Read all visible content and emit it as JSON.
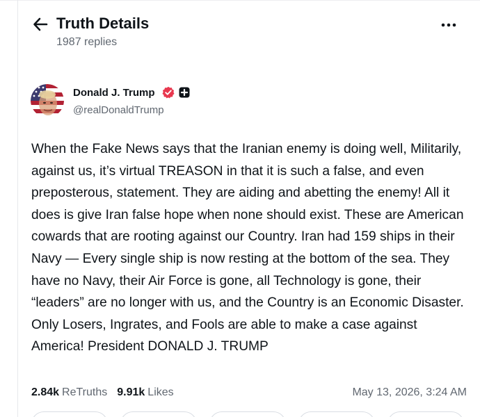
{
  "header": {
    "title": "Truth Details",
    "replies": "1987 replies",
    "back_icon": "arrow-left-icon",
    "more_icon": "more-horizontal-icon"
  },
  "author": {
    "name": "Donald J. Trump",
    "handle": "@realDonaldTrump",
    "verified_icon": "verified-badge-icon",
    "verified_color": "#e8384f",
    "plus_icon": "plus-badge-icon"
  },
  "post": {
    "text": "When the Fake News says that the Iranian enemy is doing well, Militarily, against us, it’s virtual TREASON in that it is such a false, and even preposterous, statement. They are aiding and abetting the enemy! All it does is give Iran false hope when none should exist. These are American cowards that are rooting against our Country. Iran had 159 ships in their Navy — Every single ship is now resting at the bottom of the sea. They have no Navy, their Air Force is gone, all Technology is gone, their “leaders” are no longer with us, and the Country is an Economic Disaster. Only Losers, Ingrates, and Fools are able to make a case against America! President DONALD J. TRUMP"
  },
  "stats": {
    "retruths_count": "2.84k",
    "retruths_label": "ReTruths",
    "likes_count": "9.91k",
    "likes_label": "Likes",
    "timestamp": "May 13, 2026, 3:24 AM"
  },
  "colors": {
    "text": "#0f1419",
    "muted": "#606770",
    "border": "#d9dde3"
  }
}
